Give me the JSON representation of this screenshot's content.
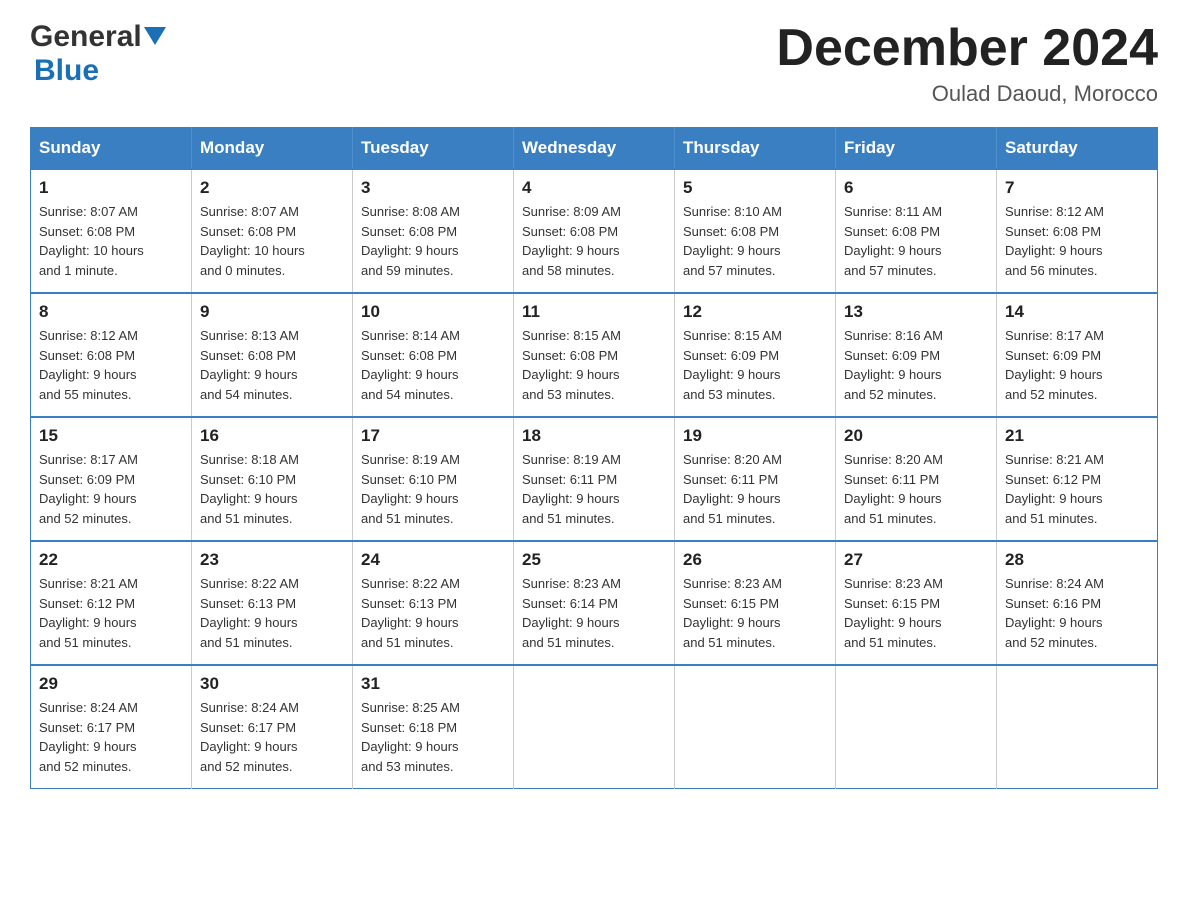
{
  "header": {
    "logo": {
      "general": "General",
      "blue": "Blue",
      "triangle": true
    },
    "title": "December 2024",
    "location": "Oulad Daoud, Morocco"
  },
  "calendar": {
    "days_of_week": [
      "Sunday",
      "Monday",
      "Tuesday",
      "Wednesday",
      "Thursday",
      "Friday",
      "Saturday"
    ],
    "weeks": [
      [
        {
          "day": 1,
          "sunrise": "8:07 AM",
          "sunset": "6:08 PM",
          "daylight": "10 hours and 1 minute."
        },
        {
          "day": 2,
          "sunrise": "8:07 AM",
          "sunset": "6:08 PM",
          "daylight": "10 hours and 0 minutes."
        },
        {
          "day": 3,
          "sunrise": "8:08 AM",
          "sunset": "6:08 PM",
          "daylight": "9 hours and 59 minutes."
        },
        {
          "day": 4,
          "sunrise": "8:09 AM",
          "sunset": "6:08 PM",
          "daylight": "9 hours and 58 minutes."
        },
        {
          "day": 5,
          "sunrise": "8:10 AM",
          "sunset": "6:08 PM",
          "daylight": "9 hours and 57 minutes."
        },
        {
          "day": 6,
          "sunrise": "8:11 AM",
          "sunset": "6:08 PM",
          "daylight": "9 hours and 57 minutes."
        },
        {
          "day": 7,
          "sunrise": "8:12 AM",
          "sunset": "6:08 PM",
          "daylight": "9 hours and 56 minutes."
        }
      ],
      [
        {
          "day": 8,
          "sunrise": "8:12 AM",
          "sunset": "6:08 PM",
          "daylight": "9 hours and 55 minutes."
        },
        {
          "day": 9,
          "sunrise": "8:13 AM",
          "sunset": "6:08 PM",
          "daylight": "9 hours and 54 minutes."
        },
        {
          "day": 10,
          "sunrise": "8:14 AM",
          "sunset": "6:08 PM",
          "daylight": "9 hours and 54 minutes."
        },
        {
          "day": 11,
          "sunrise": "8:15 AM",
          "sunset": "6:08 PM",
          "daylight": "9 hours and 53 minutes."
        },
        {
          "day": 12,
          "sunrise": "8:15 AM",
          "sunset": "6:09 PM",
          "daylight": "9 hours and 53 minutes."
        },
        {
          "day": 13,
          "sunrise": "8:16 AM",
          "sunset": "6:09 PM",
          "daylight": "9 hours and 52 minutes."
        },
        {
          "day": 14,
          "sunrise": "8:17 AM",
          "sunset": "6:09 PM",
          "daylight": "9 hours and 52 minutes."
        }
      ],
      [
        {
          "day": 15,
          "sunrise": "8:17 AM",
          "sunset": "6:09 PM",
          "daylight": "9 hours and 52 minutes."
        },
        {
          "day": 16,
          "sunrise": "8:18 AM",
          "sunset": "6:10 PM",
          "daylight": "9 hours and 51 minutes."
        },
        {
          "day": 17,
          "sunrise": "8:19 AM",
          "sunset": "6:10 PM",
          "daylight": "9 hours and 51 minutes."
        },
        {
          "day": 18,
          "sunrise": "8:19 AM",
          "sunset": "6:11 PM",
          "daylight": "9 hours and 51 minutes."
        },
        {
          "day": 19,
          "sunrise": "8:20 AM",
          "sunset": "6:11 PM",
          "daylight": "9 hours and 51 minutes."
        },
        {
          "day": 20,
          "sunrise": "8:20 AM",
          "sunset": "6:11 PM",
          "daylight": "9 hours and 51 minutes."
        },
        {
          "day": 21,
          "sunrise": "8:21 AM",
          "sunset": "6:12 PM",
          "daylight": "9 hours and 51 minutes."
        }
      ],
      [
        {
          "day": 22,
          "sunrise": "8:21 AM",
          "sunset": "6:12 PM",
          "daylight": "9 hours and 51 minutes."
        },
        {
          "day": 23,
          "sunrise": "8:22 AM",
          "sunset": "6:13 PM",
          "daylight": "9 hours and 51 minutes."
        },
        {
          "day": 24,
          "sunrise": "8:22 AM",
          "sunset": "6:13 PM",
          "daylight": "9 hours and 51 minutes."
        },
        {
          "day": 25,
          "sunrise": "8:23 AM",
          "sunset": "6:14 PM",
          "daylight": "9 hours and 51 minutes."
        },
        {
          "day": 26,
          "sunrise": "8:23 AM",
          "sunset": "6:15 PM",
          "daylight": "9 hours and 51 minutes."
        },
        {
          "day": 27,
          "sunrise": "8:23 AM",
          "sunset": "6:15 PM",
          "daylight": "9 hours and 51 minutes."
        },
        {
          "day": 28,
          "sunrise": "8:24 AM",
          "sunset": "6:16 PM",
          "daylight": "9 hours and 52 minutes."
        }
      ],
      [
        {
          "day": 29,
          "sunrise": "8:24 AM",
          "sunset": "6:17 PM",
          "daylight": "9 hours and 52 minutes."
        },
        {
          "day": 30,
          "sunrise": "8:24 AM",
          "sunset": "6:17 PM",
          "daylight": "9 hours and 52 minutes."
        },
        {
          "day": 31,
          "sunrise": "8:25 AM",
          "sunset": "6:18 PM",
          "daylight": "9 hours and 53 minutes."
        },
        null,
        null,
        null,
        null
      ]
    ]
  }
}
